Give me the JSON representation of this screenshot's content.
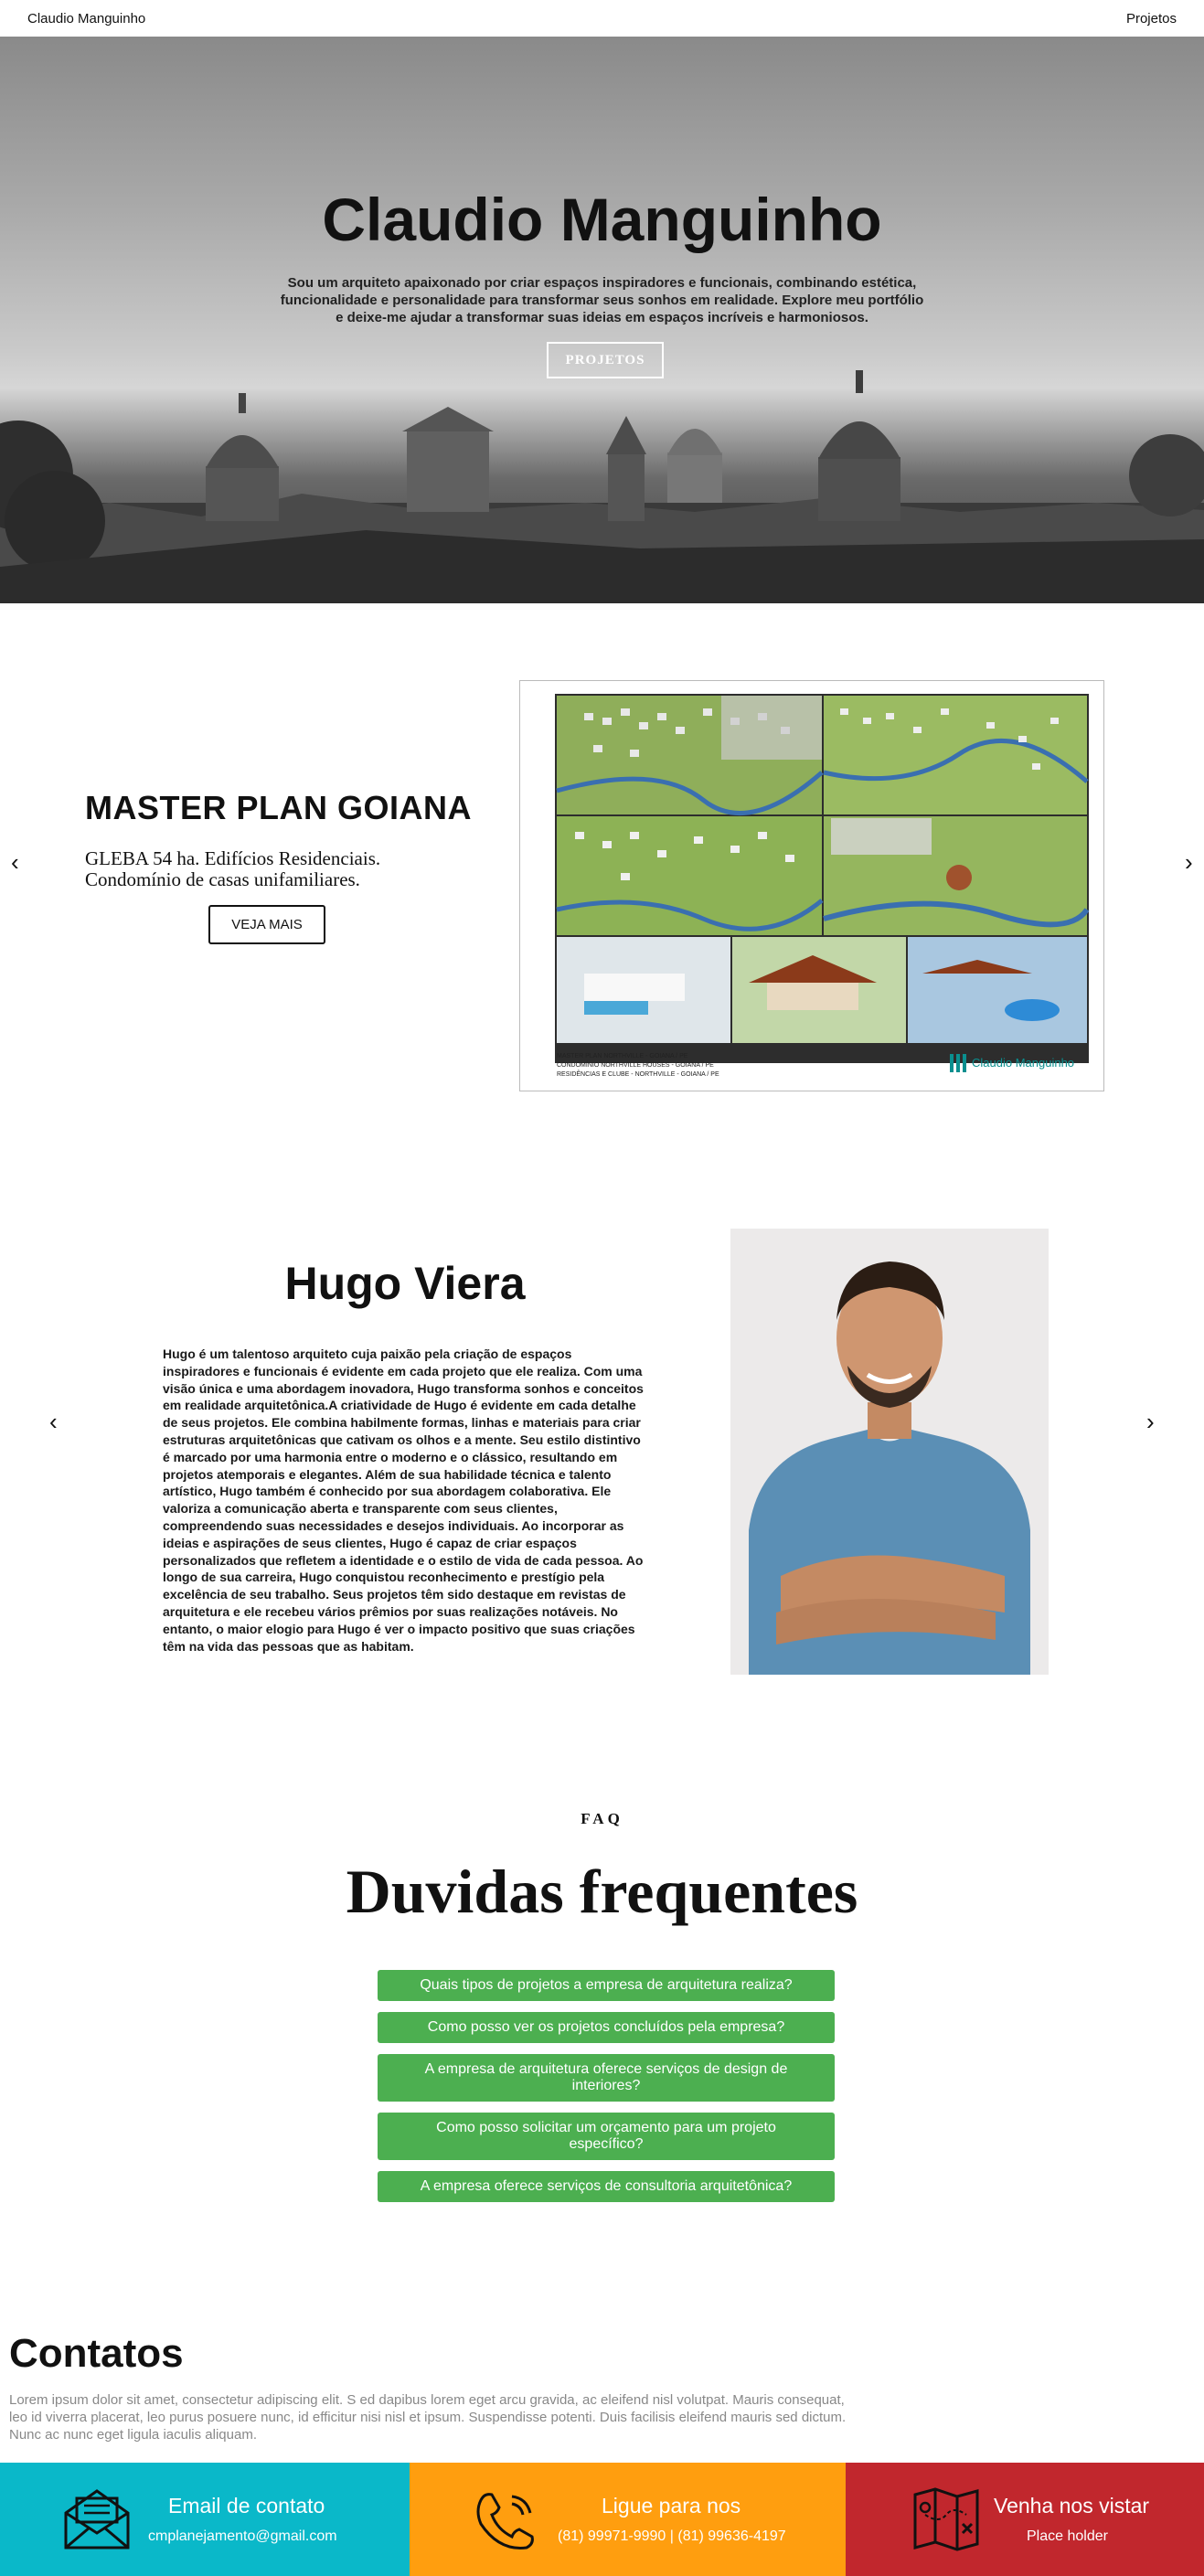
{
  "topbar": {
    "brand": "Claudio Manguinho",
    "nav_link": "Projetos"
  },
  "hero": {
    "title": "Claudio Manguinho",
    "text": "Sou um arquiteto apaixonado por criar espaços inspiradores e funcionais, combinando estética, funcionalidade e personalidade para transformar seus sonhos em realidade. Explore meu portfólio e deixe-me ajudar a transformar suas ideias em espaços incríveis e harmoniosos.",
    "button": "PROJETOS"
  },
  "project": {
    "prev": "‹",
    "next": "›",
    "title": "MASTER PLAN GOIANA",
    "description": "GLEBA 54 ha. Edifícios Residenciais. Condomínio de casas unifamiliares.",
    "button": "VEJA MAIS",
    "board": {
      "caption_lines": [
        "MASTER PLAN NORTHVILLE - GOIANA / PE",
        "CONDOMÍNIO NORTHVILLE HOUSES - GOIANA / PE",
        "RESIDÊNCIAS E CLUBE - NORTHVILLE - GOIANA / PE"
      ],
      "logo_text": "Claudio Manguinho"
    }
  },
  "person": {
    "prev": "‹",
    "next": "›",
    "name": "Hugo Viera",
    "bio": "Hugo é um talentoso arquiteto cuja paixão pela criação de espaços inspiradores e funcionais é evidente em cada projeto que ele realiza. Com uma visão única e uma abordagem inovadora, Hugo transforma sonhos e conceitos em realidade arquitetônica.A criatividade de Hugo é evidente em cada detalhe de seus projetos. Ele combina habilmente formas, linhas e materiais para criar estruturas arquitetônicas que cativam os olhos e a mente. Seu estilo distintivo é marcado por uma harmonia entre o moderno e o clássico, resultando em projetos atemporais e elegantes. Além de sua habilidade técnica e talento artístico, Hugo também é conhecido por sua abordagem colaborativa. Ele valoriza a comunicação aberta e transparente com seus clientes, compreendendo suas necessidades e desejos individuais. Ao incorporar as ideias e aspirações de seus clientes, Hugo é capaz de criar espaços personalizados que refletem a identidade e o estilo de vida de cada pessoa. Ao longo de sua carreira, Hugo conquistou reconhecimento e prestígio pela excelência de seu trabalho. Seus projetos têm sido destaque em revistas de arquitetura e ele recebeu vários prêmios por suas realizações notáveis. No entanto, o maior elogio para Hugo é ver o impacto positivo que suas criações têm na vida das pessoas que as habitam."
  },
  "faq": {
    "kicker": "FAQ",
    "title": "Duvidas frequentes",
    "items": [
      "Quais tipos de projetos a empresa de arquitetura realiza?",
      "Como posso ver os projetos concluídos pela empresa?",
      "A empresa de arquitetura oferece serviços de design de interiores?",
      "Como posso solicitar um orçamento para um projeto específico?",
      "A empresa oferece serviços de consultoria arquitetônica?"
    ],
    "button_color": "#4caf50"
  },
  "contacts": {
    "title": "Contatos",
    "text": "Lorem ipsum dolor sit amet, consectetur adipiscing elit. S ed dapibus lorem eget arcu gravida, ac eleifend nisl volutpat. Mauris consequat, leo id viverra placerat, leo purus posuere nunc, id efficitur nisi nisl et ipsum. Suspendisse potenti. Duis facilisis eleifend mauris sed dictum. Nunc ac nunc eget ligula iaculis aliquam.",
    "cards": [
      {
        "icon": "envelope-icon",
        "title": "Email de contato",
        "subtitle": "cmplanejamento@gmail.com",
        "color": "#0ab8c9"
      },
      {
        "icon": "phone-icon",
        "title": "Ligue para nos",
        "subtitle": "(81) 99971-9990 | (81) 99636-4197",
        "color": "#ff9e0f"
      },
      {
        "icon": "map-icon",
        "title": "Venha nos vistar",
        "subtitle": "Place holder",
        "color": "#c1272d"
      }
    ]
  }
}
